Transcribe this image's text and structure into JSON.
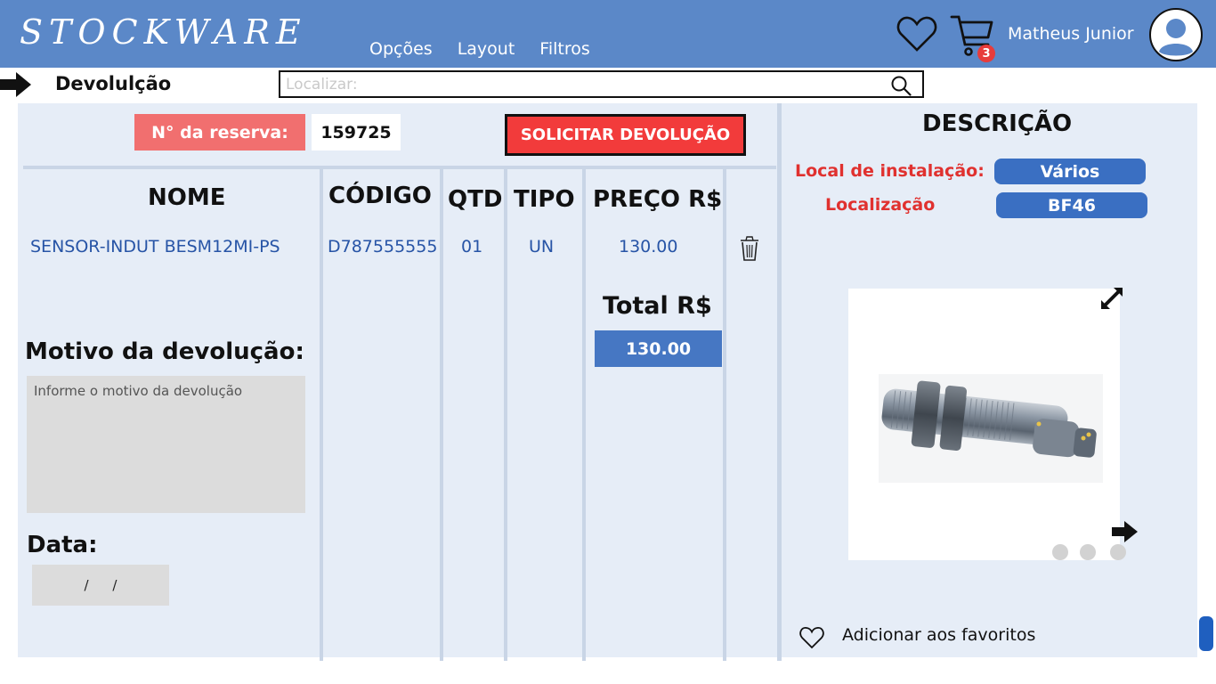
{
  "header": {
    "logo": "STOCKWARE",
    "menu": [
      "Opções",
      "Layout",
      "Filtros"
    ],
    "cart_count": "3",
    "username": "Matheus Junior"
  },
  "toolbar": {
    "page_title": "Devolulção",
    "search_placeholder": "Localizar:"
  },
  "reservation": {
    "label": "N° da reserva:",
    "number": "159725",
    "request_button": "SOLICITAR DEVOLUÇÃO"
  },
  "table": {
    "columns": [
      "NOME",
      "CÓDIGO",
      "QTD",
      "TIPO",
      "PREÇO R$"
    ],
    "rows": [
      {
        "nome": "SENSOR-INDUT BESM12MI-PS",
        "codigo": "D787555555",
        "qtd": "01",
        "tipo": "UN",
        "preco": "130.00"
      }
    ]
  },
  "total": {
    "label": "Total R$",
    "value": "130.00"
  },
  "reason": {
    "label": "Motivo da devolução:",
    "placeholder": "Informe o motivo da devolução"
  },
  "date": {
    "label": "Data:",
    "value": "/ /"
  },
  "description": {
    "title": "DESCRIÇÃO",
    "install_label": "Local de instalação:",
    "install_value": "Vários",
    "location_label": "Localização",
    "location_value": "BF46"
  },
  "gallery": {
    "slides": 3
  },
  "favorites": {
    "label": "Adicionar aos favoritos"
  },
  "colors": {
    "header_bg": "#5b88c8",
    "panel_bg": "#e6edf7",
    "accent_red": "#f23b3b",
    "accent_blue": "#3a6fc2",
    "text_blue": "#2754a6"
  }
}
